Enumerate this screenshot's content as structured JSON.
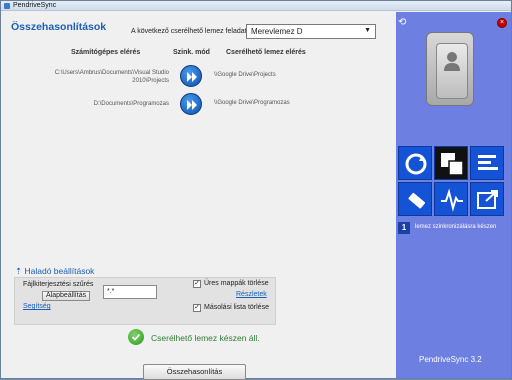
{
  "window": {
    "title": "PendriveSync"
  },
  "main": {
    "heading": "Összehasonlítások",
    "drive_label": "A következő cserélhető lemez feladatai:",
    "drive_select": "Merevlemez D",
    "columns": {
      "local": "Számítógépes elérés",
      "sync": "Szink. mód",
      "removable": "Cserélhető lemez elérés"
    },
    "rows": [
      {
        "local": "C:\\Users\\Ambrus\\Documents\\Visual Studio 2010\\Projects",
        "removable": "\\\\Google Drive\\Projects"
      },
      {
        "local": "D:\\Documents\\Programozas",
        "removable": "\\\\Google Drive\\Programozas"
      }
    ]
  },
  "advanced": {
    "link": "⇡ Haladó beállítások",
    "filter_label": "Fájlkiterjesztési szűrés",
    "default_button": "Alapbeállítás",
    "filter_value": "*.*",
    "help_link": "Segítség",
    "empty_folders_label": "Üres mappák törlése",
    "details_link": "Részletek",
    "copylist_label": "Másolási lista törlése",
    "empty_folders_checked": true,
    "copylist_checked": true
  },
  "status": {
    "text": "Cserélhető lemez készen áll."
  },
  "compare_button": "Összehasonlítás",
  "sidebar": {
    "badge": "1",
    "status": "lemez szinkronizálásra készen",
    "version": "PendriveSync 3.2",
    "close_glyph": "×",
    "refresh_glyph": "⟲"
  }
}
